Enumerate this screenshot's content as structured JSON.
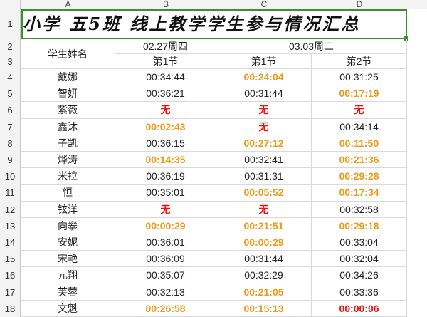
{
  "columns": [
    "A",
    "B",
    "C",
    "D"
  ],
  "title": "小学  五5班  线上教学学生参与情况汇总",
  "header": {
    "name_label": "学生姓名",
    "date1": "02.27周四",
    "date2": "03.03周二",
    "d1_s1": "第1节",
    "d2_s1": "第1节",
    "d2_s2": "第2节"
  },
  "rows": [
    {
      "num": "4",
      "name": "戴娜",
      "b": "00:34:44",
      "c": "00:24:04",
      "d": "00:31:25"
    },
    {
      "num": "5",
      "name": "智妍",
      "b": "00:36:21",
      "c": "00:31:44",
      "d": "00:17:19"
    },
    {
      "num": "6",
      "name": "紫薇",
      "b": "无",
      "c": "无",
      "d": "无"
    },
    {
      "num": "7",
      "name": "鑫沐",
      "b": "00:02:43",
      "c": "无",
      "d": "00:34:14"
    },
    {
      "num": "8",
      "name": "子凯",
      "b": "00:36:15",
      "c": "00:27:12",
      "d": "00:11:50"
    },
    {
      "num": "9",
      "name": "烨涛",
      "b": "00:14:35",
      "c": "00:32:41",
      "d": "00:21:36"
    },
    {
      "num": "10",
      "name": "米拉",
      "b": "00:36:19",
      "c": "00:31:31",
      "d": "00:29:28"
    },
    {
      "num": "11",
      "name": "恒",
      "b": "00:35:01",
      "c": "00:05:52",
      "d": "00:17:34"
    },
    {
      "num": "12",
      "name": "铉洋",
      "b": "无",
      "c": "无",
      "d": "00:32:58"
    },
    {
      "num": "13",
      "name": "向攀",
      "b": "00:00:29",
      "c": "00:21:51",
      "d": "00:29:18"
    },
    {
      "num": "14",
      "name": "安妮",
      "b": "00:36:01",
      "c": "00:00:29",
      "d": "00:33:04"
    },
    {
      "num": "15",
      "name": "宋艳",
      "b": "00:36:09",
      "c": "00:31:44",
      "d": "00:32:04"
    },
    {
      "num": "16",
      "name": "元翔",
      "b": "00:35:07",
      "c": "00:32:29",
      "d": "00:34:26"
    },
    {
      "num": "17",
      "name": "芙蓉",
      "b": "00:32:13",
      "c": "00:21:05",
      "d": "00:33:36"
    },
    {
      "num": "18",
      "name": "文魁",
      "b": "00:26:58",
      "c": "00:15:13",
      "d": "00:00:06"
    }
  ],
  "highlight": {
    "4": {
      "c": "orange"
    },
    "5": {
      "d": "orange"
    },
    "6": {
      "b": "red",
      "c": "red",
      "d": "red"
    },
    "7": {
      "b": "orange",
      "c": "red"
    },
    "8": {
      "c": "orange",
      "d": "orange"
    },
    "9": {
      "b": "orange",
      "d": "orange"
    },
    "10": {
      "d": "orange"
    },
    "11": {
      "c": "orange",
      "d": "orange"
    },
    "12": {
      "b": "red",
      "c": "red"
    },
    "13": {
      "b": "orange",
      "c": "orange",
      "d": "orange"
    },
    "14": {
      "c": "orange"
    },
    "17": {
      "c": "orange"
    },
    "18": {
      "b": "orange",
      "c": "orange",
      "d": "red"
    }
  },
  "colors": {
    "orange": "#f39a18",
    "red": "#ee1111",
    "selection": "#3f8f35"
  }
}
